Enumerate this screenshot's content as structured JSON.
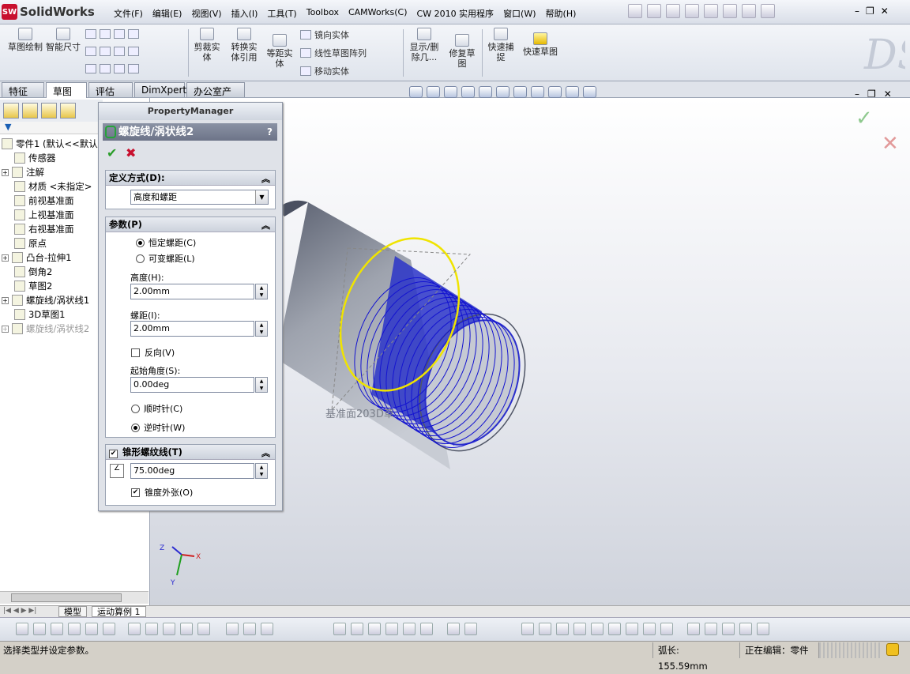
{
  "app": {
    "name": "SolidWorks",
    "logo_text": "SW"
  },
  "menu": [
    "文件(F)",
    "编辑(E)",
    "视图(V)",
    "插入(I)",
    "工具(T)",
    "Toolbox",
    "CAMWorks(C)",
    "CW 2010 实用程序",
    "窗口(W)",
    "帮助(H)"
  ],
  "ribbon": {
    "sketch": "草图绘制",
    "smart_dim": "智能尺寸",
    "trim": "剪裁实体",
    "convert": "转换实体引用",
    "offset": "等距实体",
    "mirror": "镜向实体",
    "linear_pattern": "线性草图阵列",
    "move": "移动实体",
    "show_delete": "显示/删除几...",
    "repair": "修复草图",
    "quick_snap": "快速捕捉",
    "rapid_sketch": "快速草图"
  },
  "tabs": [
    "特征",
    "草图",
    "评估",
    "DimXpert",
    "办公室产品"
  ],
  "tree": [
    {
      "label": "零件1 (默认<<默认",
      "expand": ""
    },
    {
      "label": "传感器",
      "expand": ""
    },
    {
      "label": "注解",
      "expand": "+"
    },
    {
      "label": "材质 <未指定>",
      "expand": ""
    },
    {
      "label": "前视基准面",
      "expand": ""
    },
    {
      "label": "上视基准面",
      "expand": ""
    },
    {
      "label": "右视基准面",
      "expand": ""
    },
    {
      "label": "原点",
      "expand": ""
    },
    {
      "label": "凸台-拉伸1",
      "expand": "+"
    },
    {
      "label": "倒角2",
      "expand": ""
    },
    {
      "label": "草图2",
      "expand": ""
    },
    {
      "label": "螺旋线/涡状线1",
      "expand": "+"
    },
    {
      "label": "3D草图1",
      "expand": ""
    },
    {
      "label": "螺旋线/涡状线2",
      "expand": "+"
    }
  ],
  "pm": {
    "header": "PropertyManager",
    "title": "螺旋线/涡状线2",
    "help": "?",
    "define_by_label": "定义方式(D):",
    "define_by_value": "高度和螺距",
    "params_label": "参数(P)",
    "const_pitch": "恒定螺距(C)",
    "var_pitch": "可变螺距(L)",
    "height_label": "高度(H):",
    "height_value": "2.00mm",
    "pitch_label": "螺距(I):",
    "pitch_value": "2.00mm",
    "reverse": "反向(V)",
    "start_angle_label": "起始角度(S):",
    "start_angle_value": "0.00deg",
    "clockwise": "顺时针(C)",
    "counterclockwise": "逆时针(W)",
    "taper_label": "锥形螺纹线(T)",
    "taper_value": "75.00deg",
    "taper_out": "锥度外张(O)"
  },
  "graphics": {
    "plane_label": "基准面203D草"
  },
  "bottom_tabs": [
    "模型",
    "运动算例 1"
  ],
  "status": {
    "message": "选择类型并设定参数。",
    "arc_length": "弧长: 155.59mm",
    "editing": "正在编辑：零件"
  },
  "colors": {
    "helix": "#1414d0",
    "circle": "#f0e400",
    "ok": "#2a9d2a",
    "cancel": "#c8102e"
  }
}
